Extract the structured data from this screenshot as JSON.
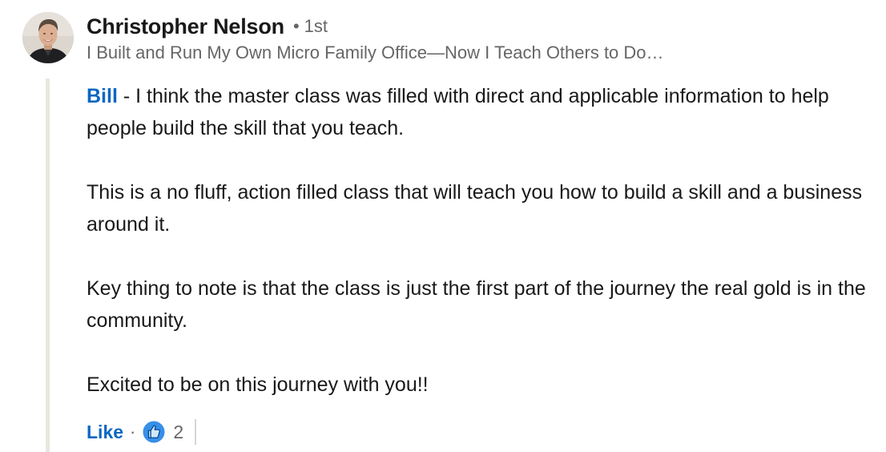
{
  "author": {
    "name": "Christopher Nelson",
    "degree_separator": "•",
    "degree": "1st",
    "headline": "I Built and Run My Own Micro Family Office—Now I Teach Others to Do…"
  },
  "comment": {
    "mention": "Bill",
    "first_line_rest": " - I think the master class was filled with direct and applicable information to help people build the skill that you teach.",
    "paragraphs": [
      "This is a no fluff, action filled class that will teach you how to build a skill and a business around it.",
      "Key thing to note is that the class is just the first part of the journey the real gold is in the community.",
      "Excited to be on this journey with you!!"
    ]
  },
  "actions": {
    "like_label": "Like",
    "separator": "·",
    "reaction_count": "2",
    "reaction_icon": "thumbs-up-icon"
  },
  "colors": {
    "link_blue": "#0a66c2",
    "text": "#191919",
    "secondary_text": "#666666",
    "thread_line": "#e8e6df"
  }
}
